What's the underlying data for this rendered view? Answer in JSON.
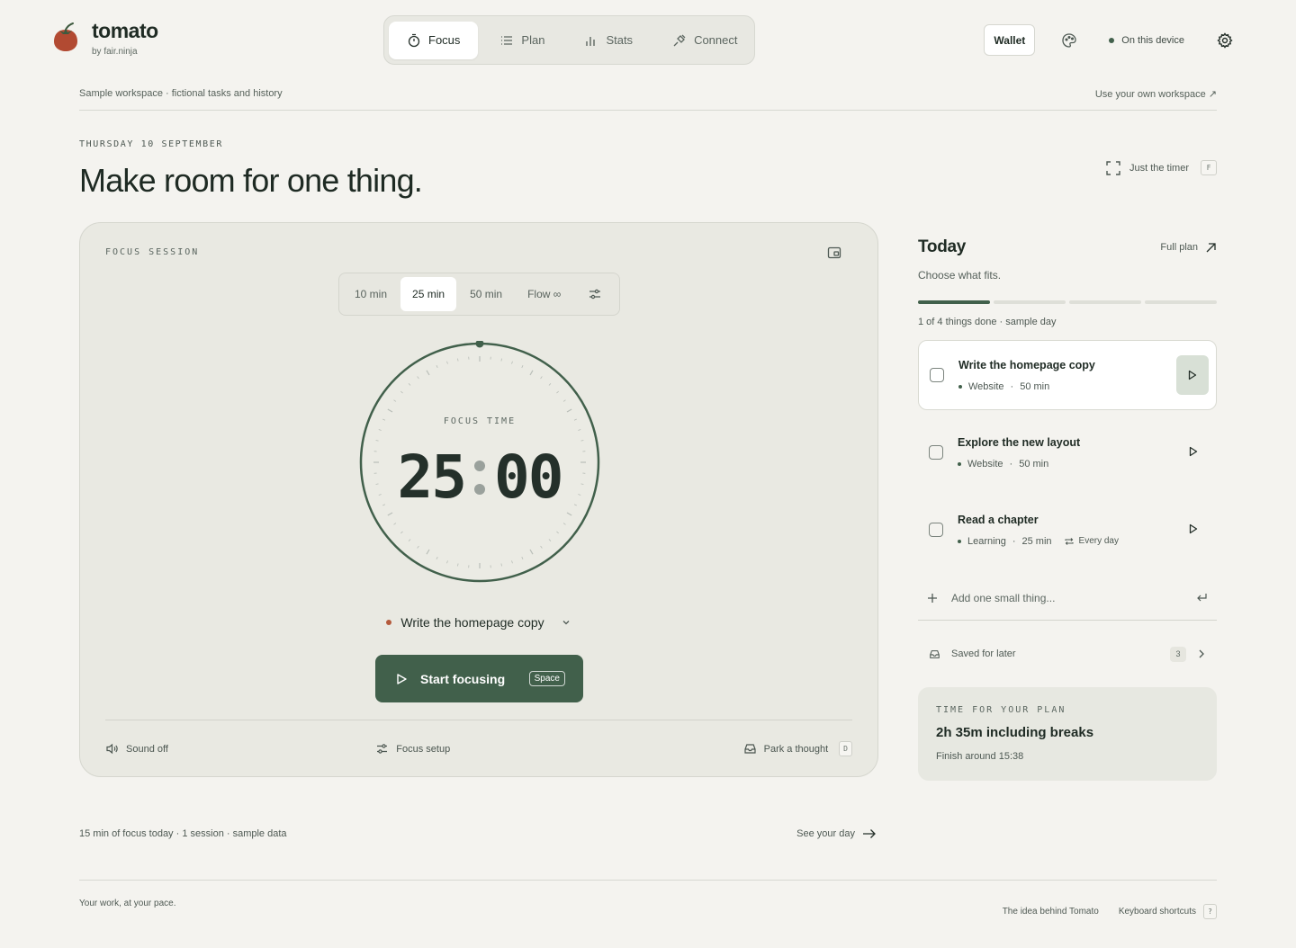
{
  "brand": {
    "name": "tomato",
    "sub": "by fair.ninja"
  },
  "nav": {
    "tabs": [
      {
        "label": "Focus",
        "icon": "timer-icon",
        "active": true
      },
      {
        "label": "Plan",
        "icon": "list-icon"
      },
      {
        "label": "Stats",
        "icon": "bar-chart-icon"
      },
      {
        "label": "Connect",
        "icon": "plug-icon"
      }
    ]
  },
  "header": {
    "wallet": "Wallet",
    "device": "On this device"
  },
  "workspace": {
    "label": "Sample workspace · fictional tasks and history",
    "link": "Use your own workspace ↗"
  },
  "page": {
    "date": "THURSDAY 10 SEPTEMBER",
    "headline": "Make room for one thing.",
    "just_timer": "Just the timer",
    "just_timer_key": "F"
  },
  "focus": {
    "label": "FOCUS SESSION",
    "durations": [
      "10 min",
      "25 min",
      "50 min",
      "Flow ∞"
    ],
    "active_duration": "25 min",
    "dial_label": "FOCUS TIME",
    "minutes": "25",
    "seconds": "00",
    "task": "Write the homepage copy",
    "start": "Start focusing",
    "start_key": "Space",
    "sound": "Sound off",
    "setup": "Focus setup",
    "park": "Park a thought",
    "park_key": "D"
  },
  "summary": {
    "text": "15 min of focus today · 1 session · sample data",
    "link": "See your day"
  },
  "today": {
    "title": "Today",
    "full_plan": "Full plan",
    "subtitle": "Choose what fits.",
    "progress_done": 1,
    "progress_total": 4,
    "progress_text": "1 of 4 things done · sample day",
    "tasks": [
      {
        "name": "Write the homepage copy",
        "project": "Website",
        "duration": "50 min",
        "repeat": ""
      },
      {
        "name": "Explore the new layout",
        "project": "Website",
        "duration": "50 min",
        "repeat": ""
      },
      {
        "name": "Read a chapter",
        "project": "Learning",
        "duration": "25 min",
        "repeat": "Every day"
      }
    ],
    "add_placeholder": "Add one small thing...",
    "saved_label": "Saved for later",
    "saved_count": "3",
    "plan_time_label": "TIME FOR YOUR PLAN",
    "plan_time": "2h 35m including breaks",
    "finish": "Finish around 15:38"
  },
  "footer": {
    "tagline": "Your work, at your pace.",
    "idea": "The idea behind Tomato",
    "shortcuts": "Keyboard shortcuts",
    "shortcuts_key": "?"
  },
  "colors": {
    "accent": "#41604b",
    "tomato": "#b45a3c",
    "background": "#f4f3ef",
    "card": "#e9e9e2"
  }
}
